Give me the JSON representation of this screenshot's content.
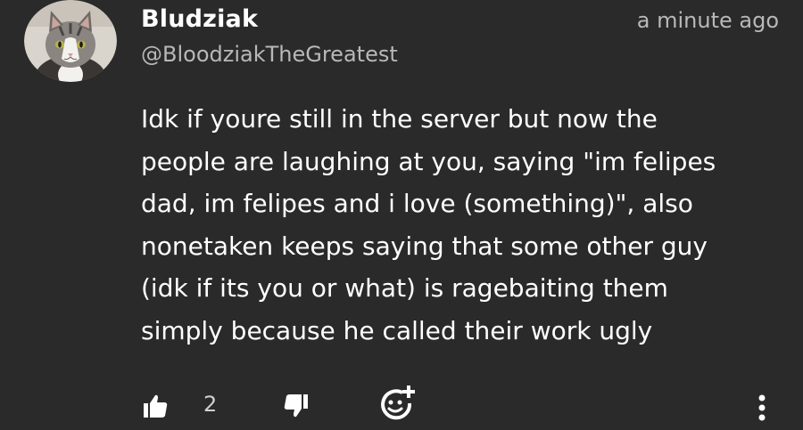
{
  "comment": {
    "author_name": "Bludziak",
    "author_handle": "@BloodziakTheGreatest",
    "timestamp": "a minute ago",
    "text": "Idk if youre still in the server but now the\npeople are laughing at you, saying \"im felipes\ndad, im felipes and i love (something)\", also\nnonetaken keeps saying that some other guy\n(idk if its you or what) is ragebaiting them\nsimply because he called their work ugly",
    "like_count": "2"
  },
  "icons": {
    "avatar": "cat-avatar",
    "like": "thumbs-up-icon",
    "dislike": "thumbs-down-icon",
    "react": "add-reaction-icon",
    "more": "more-vertical-icon"
  },
  "colors": {
    "background": "#2a2a2a",
    "primary_text": "#ffffff",
    "secondary_text": "#b8b8b8"
  }
}
